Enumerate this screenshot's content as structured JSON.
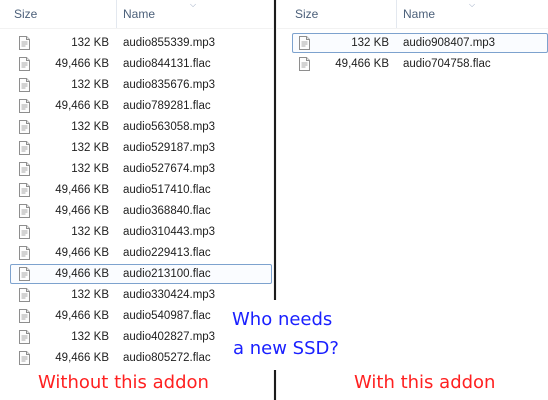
{
  "left_pane": {
    "columns": {
      "size": "Size",
      "name": "Name"
    },
    "rows": [
      {
        "size": "132 KB",
        "name": "audio855339.mp3"
      },
      {
        "size": "49,466 KB",
        "name": "audio844131.flac"
      },
      {
        "size": "132 KB",
        "name": "audio835676.mp3"
      },
      {
        "size": "49,466 KB",
        "name": "audio789281.flac"
      },
      {
        "size": "132 KB",
        "name": "audio563058.mp3"
      },
      {
        "size": "132 KB",
        "name": "audio529187.mp3"
      },
      {
        "size": "132 KB",
        "name": "audio527674.mp3"
      },
      {
        "size": "49,466 KB",
        "name": "audio517410.flac"
      },
      {
        "size": "49,466 KB",
        "name": "audio368840.flac"
      },
      {
        "size": "132 KB",
        "name": "audio310443.mp3"
      },
      {
        "size": "49,466 KB",
        "name": "audio229413.flac"
      },
      {
        "size": "49,466 KB",
        "name": "audio213100.flac",
        "selected": true
      },
      {
        "size": "132 KB",
        "name": "audio330424.mp3"
      },
      {
        "size": "49,466 KB",
        "name": "audio540987.flac"
      },
      {
        "size": "132 KB",
        "name": "audio402827.mp3"
      },
      {
        "size": "49,466 KB",
        "name": "audio805272.flac"
      }
    ]
  },
  "right_pane": {
    "columns": {
      "size": "Size",
      "name": "Name"
    },
    "rows": [
      {
        "size": "132 KB",
        "name": "audio908407.mp3",
        "selected": true
      },
      {
        "size": "49,466 KB",
        "name": "audio704758.flac"
      }
    ]
  },
  "captions": {
    "left": "Without this addon",
    "right": "With this addon",
    "speech_line1": "Who needs",
    "speech_line2": "a new SSD?"
  },
  "colors": {
    "caption": "#ff2020",
    "speech": "#1a20ff",
    "header_text": "#4c607a",
    "selection_border": "#7da2ce"
  },
  "icons": {
    "file": "document-icon",
    "sort": "sort-chevron-icon"
  }
}
